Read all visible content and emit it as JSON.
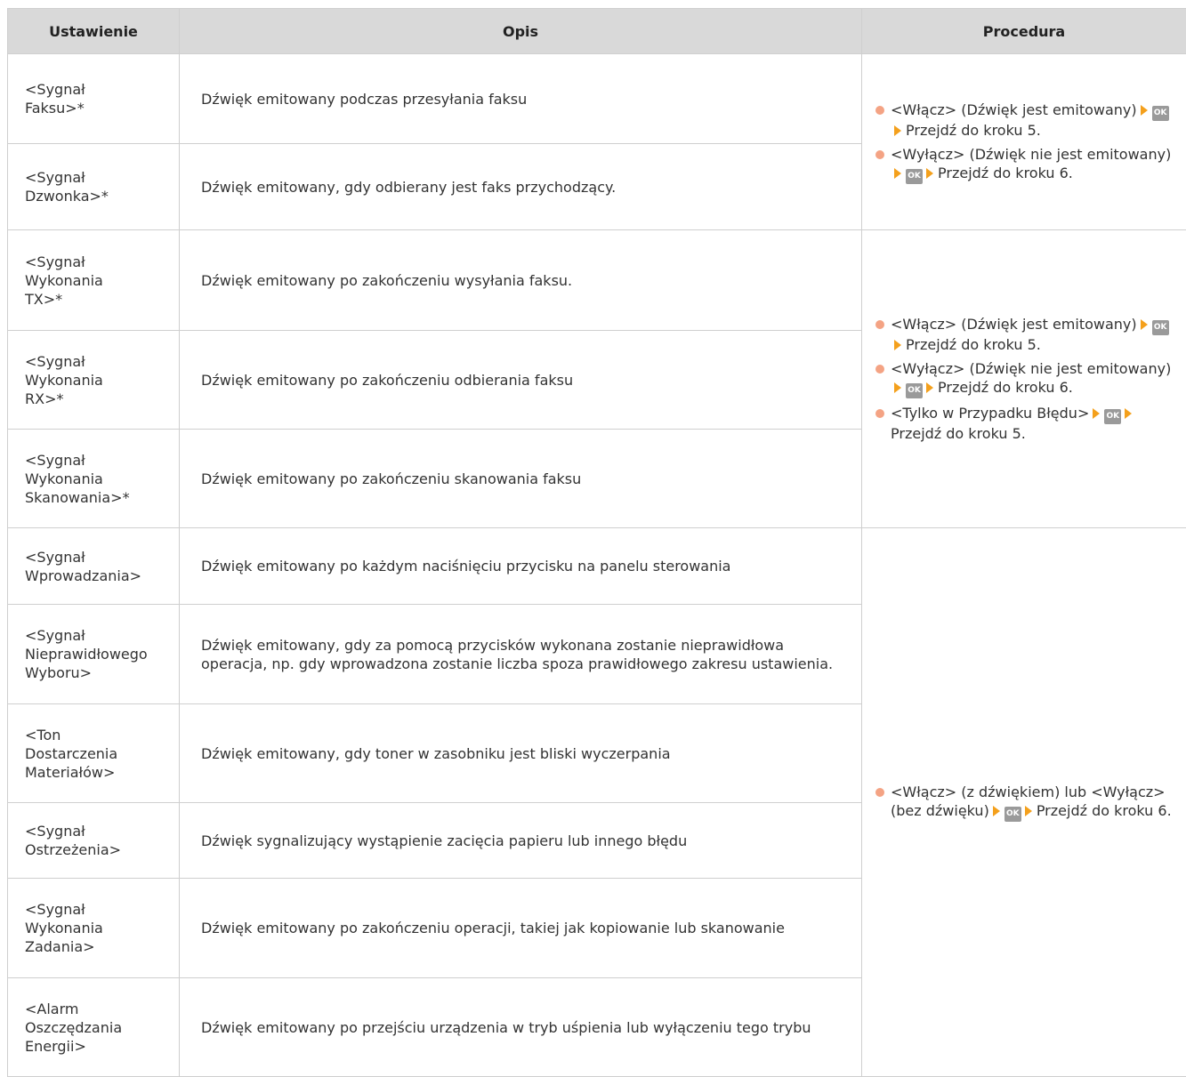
{
  "headers": {
    "setting": "Ustawienie",
    "description": "Opis",
    "procedure": "Procedura"
  },
  "rows": [
    {
      "setting": "<Sygnał\nFaksu>*",
      "description": "Dźwięk emitowany podczas przesyłania faksu"
    },
    {
      "setting": "<Sygnał\nDzwonka>*",
      "description": "Dźwięk emitowany, gdy odbierany jest faks przychodzący."
    },
    {
      "setting": "<Sygnał\nWykonania\nTX>*",
      "description": "Dźwięk emitowany po zakończeniu wysyłania faksu."
    },
    {
      "setting": "<Sygnał\nWykonania\nRX>*",
      "description": "Dźwięk emitowany po zakończeniu odbierania faksu"
    },
    {
      "setting": "<Sygnał\nWykonania\nSkanowania>*",
      "description": "Dźwięk emitowany po zakończeniu skanowania faksu"
    },
    {
      "setting": "<Sygnał\nWprowadzania>",
      "description": "Dźwięk emitowany po każdym naciśnięciu przycisku na panelu sterowania"
    },
    {
      "setting": "<Sygnał\nNieprawidłowego\nWyboru>",
      "description": "Dźwięk emitowany, gdy za pomocą przycisków wykonana zostanie nieprawidłowa operacja, np. gdy wprowadzona zostanie liczba spoza prawidłowego zakresu ustawienia."
    },
    {
      "setting": "<Ton\nDostarczenia\nMateriałów>",
      "description": "Dźwięk emitowany, gdy toner w zasobniku jest bliski wyczerpania"
    },
    {
      "setting": "<Sygnał\nOstrzeżenia>",
      "description": "Dźwięk sygnalizujący wystąpienie zacięcia papieru lub innego błędu"
    },
    {
      "setting": "<Sygnał\nWykonania\nZadania>",
      "description": "Dźwięk emitowany po zakończeniu operacji, takiej jak kopiowanie lub skanowanie"
    },
    {
      "setting": "<Alarm\nOszczędzania\nEnergii>",
      "description": "Dźwięk emitowany po przejściu urządzenia w tryb uśpienia lub wyłączeniu tego trybu"
    }
  ],
  "procedures": {
    "group1": [
      {
        "option": "<Włącz> (Dźwięk jest emitowany)",
        "key": "OK",
        "action": "Przejdź do kroku 5."
      },
      {
        "option": "<Wyłącz> (Dźwięk nie jest emitowany)",
        "key": "OK",
        "action": "Przejdź do kroku 6."
      }
    ],
    "group2": [
      {
        "option": "<Włącz> (Dźwięk jest emitowany)",
        "key": "OK",
        "action": "Przejdź do kroku 5."
      },
      {
        "option": "<Wyłącz> (Dźwięk nie jest emitowany)",
        "key": "OK",
        "action": "Przejdź do kroku 6."
      },
      {
        "option": "<Tylko w Przypadku Błędu>",
        "key": "OK",
        "action": "Przejdź do kroku 5."
      }
    ],
    "group3": [
      {
        "option": "<Włącz> (z dźwiękiem) lub <Wyłącz> (bez dźwięku)",
        "key": "OK",
        "action": "Przejdź do kroku 6."
      }
    ]
  },
  "colors": {
    "header_bg": "#d9d9d9",
    "border": "#cfcfcf",
    "bullet": "#f4a384",
    "arrow": "#f4a01c",
    "ok_key": "#9a9a9a"
  }
}
